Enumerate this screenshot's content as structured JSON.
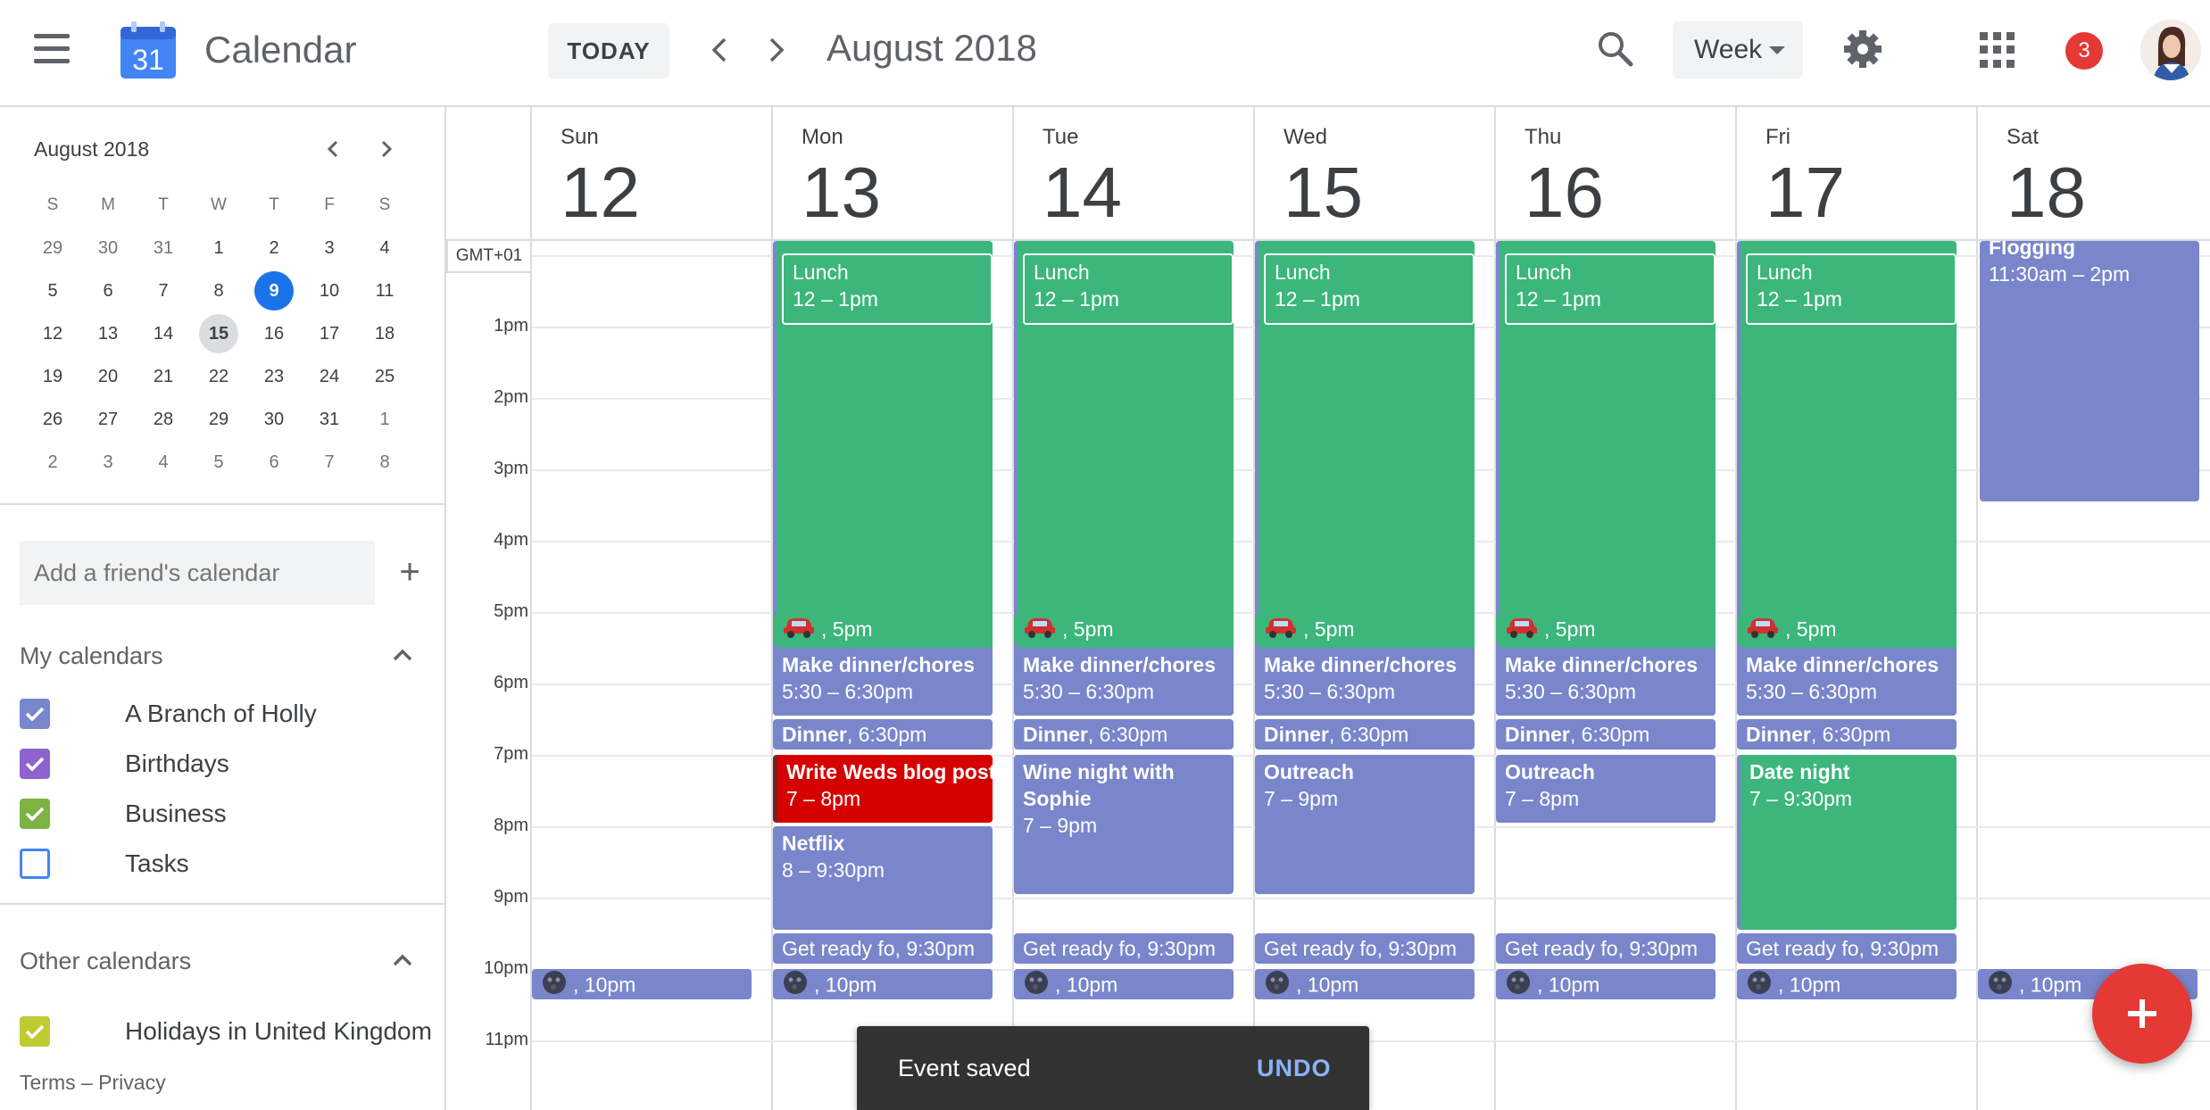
{
  "header": {
    "app_title": "Calendar",
    "logo_day": "31",
    "today_label": "TODAY",
    "month_label": "August 2018",
    "view_selected": "Week",
    "notifications": "3"
  },
  "sidebar": {
    "mini_month": "August 2018",
    "weekday_heads": [
      "S",
      "M",
      "T",
      "W",
      "T",
      "F",
      "S"
    ],
    "weeks": [
      [
        "29",
        "30",
        "31",
        "1",
        "2",
        "3",
        "4"
      ],
      [
        "5",
        "6",
        "7",
        "8",
        "9",
        "10",
        "11"
      ],
      [
        "12",
        "13",
        "14",
        "15",
        "16",
        "17",
        "18"
      ],
      [
        "19",
        "20",
        "21",
        "22",
        "23",
        "24",
        "25"
      ],
      [
        "26",
        "27",
        "28",
        "29",
        "30",
        "31",
        "1"
      ],
      [
        "2",
        "3",
        "4",
        "5",
        "6",
        "7",
        "8"
      ]
    ],
    "friend_placeholder": "Add a friend's calendar",
    "my_calendars_title": "My calendars",
    "my_calendars": [
      {
        "label": "A Branch of Holly",
        "color": "#7986cb",
        "checked": true
      },
      {
        "label": "Birthdays",
        "color": "#8e63ce",
        "checked": true
      },
      {
        "label": "Business",
        "color": "#7cb342",
        "checked": true
      },
      {
        "label": "Tasks",
        "color": "#4285f4",
        "checked": false
      }
    ],
    "other_calendars_title": "Other calendars",
    "other_calendars": [
      {
        "label": "Holidays in United Kingdom",
        "color": "#c0ca33",
        "checked": true
      }
    ],
    "footer": "Terms – Privacy"
  },
  "grid": {
    "timezone": "GMT+01",
    "days": [
      {
        "name": "Sun",
        "num": "12"
      },
      {
        "name": "Mon",
        "num": "13"
      },
      {
        "name": "Tue",
        "num": "14"
      },
      {
        "name": "Wed",
        "num": "15"
      },
      {
        "name": "Thu",
        "num": "16"
      },
      {
        "name": "Fri",
        "num": "17"
      },
      {
        "name": "Sat",
        "num": "18"
      }
    ],
    "hours": [
      "1pm",
      "2pm",
      "3pm",
      "4pm",
      "5pm",
      "6pm",
      "7pm",
      "8pm",
      "9pm",
      "10pm",
      "11pm"
    ],
    "events": {
      "lunch_title": "Lunch",
      "lunch_time": "12 – 1pm",
      "drive_time": ", 5pm",
      "chores_title": "Make dinner/chores",
      "chores_time": "5:30 – 6:30pm",
      "dinner_title": "Dinner",
      "dinner_time": ", 6:30pm",
      "blog_title": "Write Weds blog post",
      "blog_time": "7 – 8pm",
      "netflix_title": "Netflix",
      "netflix_time": "8 – 9:30pm",
      "wine_title": "Wine night with Sophie",
      "wine_time": "7 – 9pm",
      "outreach_title": "Outreach",
      "outreach_wed_time": "7 – 9pm",
      "outreach_thu_time": "7 – 8pm",
      "date_title": "Date night",
      "date_time": "7 – 9:30pm",
      "getready_title": "Get ready fo",
      "getready_time": ", 9:30pm",
      "sleep_time": ", 10pm",
      "sat_title": "Flogging",
      "sat_time": "11:30am – 2pm"
    }
  },
  "snackbar": {
    "message": "Event saved",
    "action": "UNDO"
  },
  "colors": {
    "green": "#3cb67b",
    "purple": "#7986cb",
    "red": "#d50000",
    "accent_blue": "#1a73e8",
    "fab": "#e53935"
  }
}
